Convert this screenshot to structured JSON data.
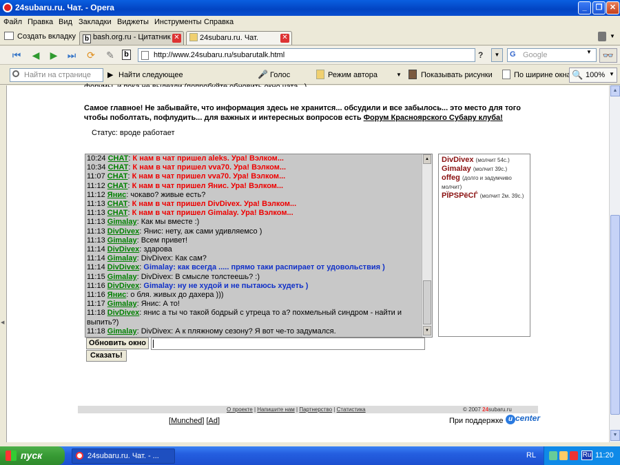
{
  "window": {
    "title": "24subaru.ru. Чат. - Opera"
  },
  "menubar": [
    "Файл",
    "Правка",
    "Вид",
    "Закладки",
    "Виджеты",
    "Инструменты",
    "Справка"
  ],
  "tabs": {
    "new_tab": "Создать вкладку",
    "items": [
      {
        "label": "bash.org.ru - Цитатник ..."
      },
      {
        "label": "24subaru.ru. Чат."
      }
    ]
  },
  "address": {
    "url": "http://www.24subaru.ru/subarutalk.html",
    "search_placeholder": "Google"
  },
  "toolbar2": {
    "find_placeholder": "Найти на странице",
    "find_next": "Найти следующее",
    "voice": "Голос",
    "author_mode": "Режим автора",
    "show_images": "Показывать рисунки",
    "fit_width": "По ширине окна",
    "zoom": "100%"
  },
  "page": {
    "cut_text": "форумы, и пока не вылезли (попробуйте обновить окно чата...)",
    "notice": "Самое главное! Не забывайте, что информация здесь не хранится... обсудили и все забылось... это место для того чтобы поболтать, пофлудить... для важных и интересных вопросов есть ",
    "notice_link": "Форум Красноярского Субару клуба!",
    "status": "Статус: вроде работает",
    "chat": [
      {
        "time": "10:24",
        "nick": "CHAT",
        "nick_color": "#008000",
        "sep": ": ",
        "text": "К нам в чат пришел aleks. Ура! Вэлком...",
        "style": "sys"
      },
      {
        "time": "10:34",
        "nick": "CHAT",
        "nick_color": "#008000",
        "sep": ": ",
        "text": "К нам в чат пришел vva70. Ура! Вэлком...",
        "style": "sys"
      },
      {
        "time": "11:07",
        "nick": "CHAT",
        "nick_color": "#008000",
        "sep": ": ",
        "text": "К нам в чат пришел vva70. Ура! Вэлком...",
        "style": "sys"
      },
      {
        "time": "11:12",
        "nick": "CHAT",
        "nick_color": "#008000",
        "sep": ": ",
        "text": "К нам в чат пришел Янис. Ура! Вэлком...",
        "style": "sys"
      },
      {
        "time": "11:12",
        "nick": "Янис",
        "nick_color": "#008000",
        "sep": ": ",
        "text": "чокаво? живые есть?",
        "style": "plain"
      },
      {
        "time": "11:13",
        "nick": "CHAT",
        "nick_color": "#008000",
        "sep": ": ",
        "text": "К нам в чат пришел DivDivex. Ура! Вэлком...",
        "style": "sys"
      },
      {
        "time": "11:13",
        "nick": "CHAT",
        "nick_color": "#008000",
        "sep": ": ",
        "text": "К нам в чат пришел Gimalay. Ура! Вэлком...",
        "style": "sys"
      },
      {
        "time": "11:13",
        "nick": "Gimalay",
        "nick_color": "#008000",
        "sep": ": ",
        "text": "Как мы вместе :)",
        "style": "plain"
      },
      {
        "time": "11:13",
        "nick": "DivDivex",
        "nick_color": "#008000",
        "sep": ": ",
        "text": "Янис: нету, аж сами удивляемсо )",
        "style": "plain"
      },
      {
        "time": "11:13",
        "nick": "Gimalay",
        "nick_color": "#008000",
        "sep": ": ",
        "text": "Всем привет!",
        "style": "plain"
      },
      {
        "time": "11:14",
        "nick": "DivDivex",
        "nick_color": "#008000",
        "sep": ": ",
        "text": "здарова",
        "style": "plain"
      },
      {
        "time": "11:14",
        "nick": "Gimalay",
        "nick_color": "#008000",
        "sep": ": ",
        "text": "DivDivex: Как сам?",
        "style": "plain"
      },
      {
        "time": "11:14",
        "nick": "DivDivex",
        "nick_color": "#008000",
        "sep": ": ",
        "text": "Gimalay: как всегда ..... прямо таки распирает от удовольствия )",
        "style": "blue"
      },
      {
        "time": "11:15",
        "nick": "Gimalay",
        "nick_color": "#008000",
        "sep": ": ",
        "text": "DivDivex: В смысле толстеешь? :)",
        "style": "plain"
      },
      {
        "time": "11:16",
        "nick": "DivDivex",
        "nick_color": "#008000",
        "sep": ": ",
        "text": "Gimalay: ну не худой и не пытаюсь худеть )",
        "style": "blue"
      },
      {
        "time": "11:16",
        "nick": "Янис",
        "nick_color": "#008000",
        "sep": ": ",
        "text": "о бля. живых до дахера )))",
        "style": "plain"
      },
      {
        "time": "11:17",
        "nick": "Gimalay",
        "nick_color": "#008000",
        "sep": ": ",
        "text": "Янис: А то!",
        "style": "plain"
      },
      {
        "time": "11:18",
        "nick": "DivDivex",
        "nick_color": "#008000",
        "sep": ": ",
        "text": "янис а ты чо такой бодрый с утреца то а? похмельный синдром - найти и выпить?)",
        "style": "plain"
      },
      {
        "time": "11:18",
        "nick": "Gimalay",
        "nick_color": "#008000",
        "sep": ": ",
        "text": "DivDivex: А к пляжному сезону? Я вот че-то задумался.",
        "style": "plain"
      }
    ],
    "users": [
      {
        "name": "DivDivex",
        "idle": "(молчит 54с.)"
      },
      {
        "name": "Gimalay",
        "idle": "(молчит 39с.)"
      },
      {
        "name": "offeg",
        "idle": "(долго и задумчиво молчит)"
      },
      {
        "name": "PÏPSPëCЃ",
        "idle": "(молчит 2м. 39с.)"
      }
    ],
    "refresh_button": "Обновить окно",
    "say_button": "Сказать!",
    "footer_links": [
      "О проекте",
      "Напишите нам",
      "Партнерство",
      "Статистика"
    ],
    "copyright_prefix": "© 2007 ",
    "copyright_brand": "24",
    "copyright_suffix": "subaru.ru",
    "munched": "Munched",
    "ad": "Ad",
    "support": "При поддержке",
    "ucenter": "center"
  },
  "taskbar": {
    "start": "пуск",
    "task": "24subaru.ru. Чат. - ...",
    "lang": "RL",
    "tray_lang": "Ru",
    "clock": "11:20"
  },
  "colors": {
    "sys": "#e00000",
    "blue": "#1030c8",
    "nick": "#008000",
    "user": "#8a1010"
  }
}
